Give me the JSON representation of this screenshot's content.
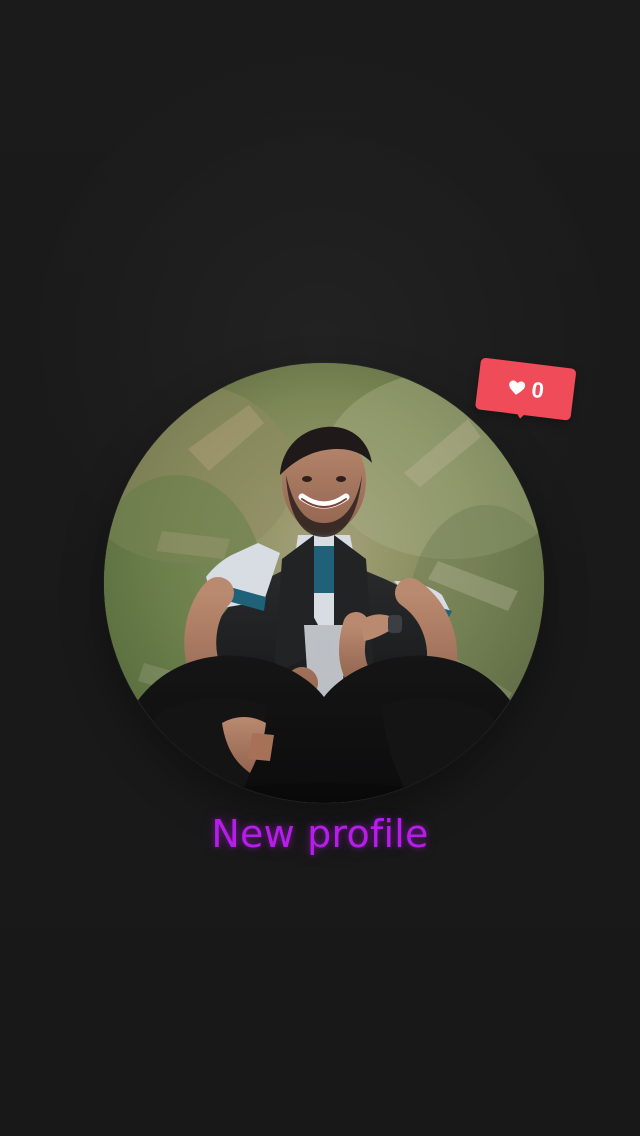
{
  "badge": {
    "count": "0",
    "heart_icon": "heart-icon",
    "color": "#ef4b59"
  },
  "profile": {
    "title": "New profile",
    "title_color": "#b61de8"
  }
}
